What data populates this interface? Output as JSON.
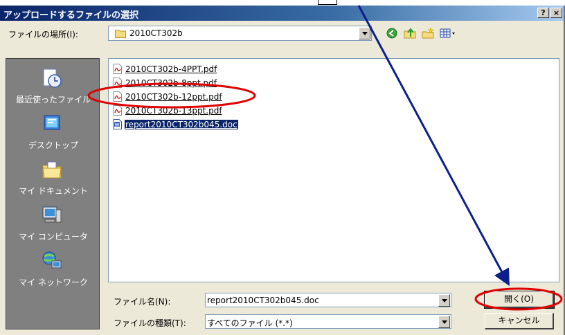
{
  "window": {
    "title": "アップロードするファイルの選択",
    "help_button": "?",
    "close_button": "×"
  },
  "lookin": {
    "label": "ファイルの場所(I):",
    "value": "2010CT302b"
  },
  "toolbar": {
    "icons": [
      "back-icon",
      "up-folder-icon",
      "new-folder-icon",
      "view-menu-icon"
    ]
  },
  "places": [
    {
      "label": "最近使ったファイル",
      "icon": "recent-files-icon"
    },
    {
      "label": "デスクトップ",
      "icon": "desktop-icon"
    },
    {
      "label": "マイ ドキュメント",
      "icon": "my-documents-icon"
    },
    {
      "label": "マイ コンピュータ",
      "icon": "my-computer-icon"
    },
    {
      "label": "マイ ネットワーク",
      "icon": "my-network-icon"
    }
  ],
  "files": [
    {
      "name": "2010CT302b-4PPT.pdf",
      "type": "pdf"
    },
    {
      "name": "2010CT302b-8ppt.pdf",
      "type": "pdf"
    },
    {
      "name": "2010CT302b-12ppt.pdf",
      "type": "pdf"
    },
    {
      "name": "2010CT302b-13ppt.pdf",
      "type": "pdf"
    },
    {
      "name": "report2010CT302b045.doc",
      "type": "doc",
      "selected": true
    }
  ],
  "filename": {
    "label": "ファイル名(N):",
    "value": "report2010CT302b045.doc"
  },
  "filetype": {
    "label": "ファイルの種類(T):",
    "value": "すべてのファイル (*.*)"
  },
  "buttons": {
    "open": "開く(O)",
    "cancel": "キャンセル"
  },
  "colors": {
    "annotation_red": "#e00000",
    "annotation_arrow": "#0b1e8c",
    "selection": "#0a246a"
  }
}
